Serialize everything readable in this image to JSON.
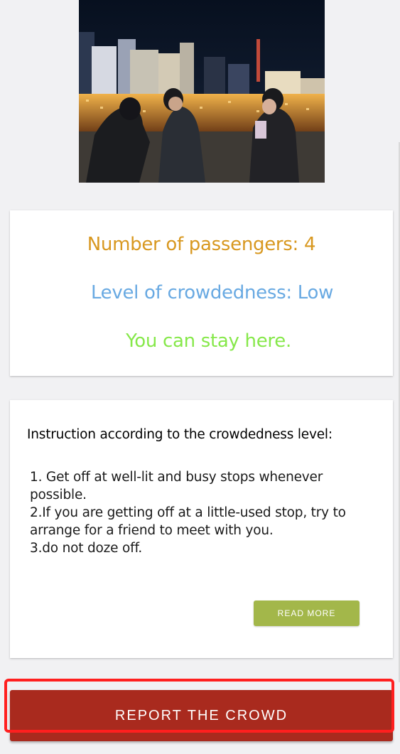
{
  "photo": {
    "icon": "crowd-photo"
  },
  "status": {
    "passengers": "Number of passengers: 4",
    "crowdedness": "Level of crowdedness: Low",
    "advice": "You can stay here.",
    "colors": {
      "passengers": "#d89820",
      "crowdedness": "#68a9e2",
      "advice": "#86e84a"
    }
  },
  "instructions": {
    "title": "Instruction according to the crowdedness level:",
    "items": [
      "1. Get off at well-lit and busy stops whenever possible.",
      "2.If you are getting off at a little-used stop, try to arrange for a friend to meet with you.",
      "3.do not doze off."
    ],
    "read_more_label": "READ MORE",
    "read_more_color": "#a3b74a"
  },
  "report": {
    "label": "REPORT THE CROWD",
    "color": "#a92a1e",
    "highlight_color": "#ff1f1f"
  }
}
